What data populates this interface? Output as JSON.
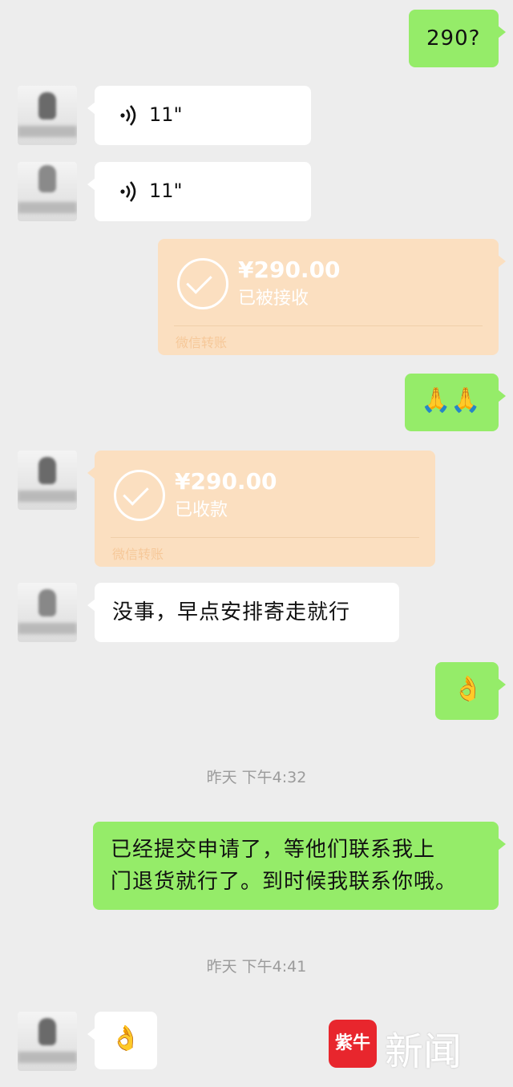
{
  "messages": {
    "m1": {
      "text": "290?"
    },
    "m2": {
      "duration": "11\""
    },
    "m3": {
      "duration": "11\""
    },
    "m4": {
      "amount": "¥290.00",
      "status": "已被接收",
      "footer": "微信转账"
    },
    "m5": {
      "emoji": "🙏🙏"
    },
    "m6": {
      "amount": "¥290.00",
      "status": "已收款",
      "footer": "微信转账"
    },
    "m7": {
      "text": "没事，早点安排寄走就行"
    },
    "m8": {
      "emoji": "👌"
    },
    "time1": "昨天 下午4:32",
    "m9": {
      "line1": "已经提交申请了，等他们联系我上",
      "line2": "门退货就行了。到时候我联系你哦。"
    },
    "time2": "昨天 下午4:41",
    "m10": {
      "emoji": "👌"
    }
  },
  "watermark": {
    "logo_char": "紫牛",
    "text": "新闻"
  },
  "colors": {
    "background": "#ededed",
    "outgoing_bubble": "#95ec69",
    "incoming_bubble": "#ffffff",
    "transfer_card": "#fbdfc0",
    "logo_red": "#e8262d"
  },
  "icons": [
    "voice-wave-icon",
    "check-circle-icon",
    "avatar-blurred"
  ]
}
